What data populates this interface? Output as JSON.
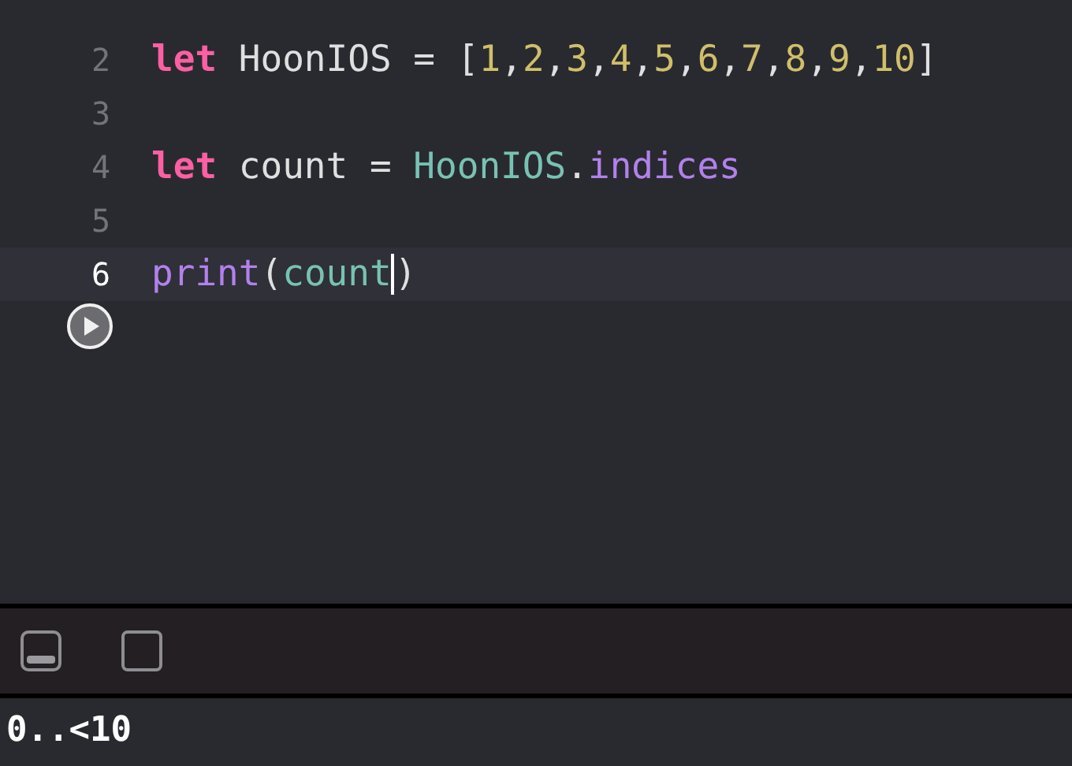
{
  "editor": {
    "lines": [
      {
        "number": "2",
        "current": false,
        "tokens": [
          {
            "kind": "keyword",
            "text": "let"
          },
          {
            "kind": "plain",
            "text": " HoonIOS = ["
          },
          {
            "kind": "number",
            "text": "1"
          },
          {
            "kind": "plain",
            "text": ","
          },
          {
            "kind": "number",
            "text": "2"
          },
          {
            "kind": "plain",
            "text": ","
          },
          {
            "kind": "number",
            "text": "3"
          },
          {
            "kind": "plain",
            "text": ","
          },
          {
            "kind": "number",
            "text": "4"
          },
          {
            "kind": "plain",
            "text": ","
          },
          {
            "kind": "number",
            "text": "5"
          },
          {
            "kind": "plain",
            "text": ","
          },
          {
            "kind": "number",
            "text": "6"
          },
          {
            "kind": "plain",
            "text": ","
          },
          {
            "kind": "number",
            "text": "7"
          },
          {
            "kind": "plain",
            "text": ","
          },
          {
            "kind": "number",
            "text": "8"
          },
          {
            "kind": "plain",
            "text": ","
          },
          {
            "kind": "number",
            "text": "9"
          },
          {
            "kind": "plain",
            "text": ","
          },
          {
            "kind": "number",
            "text": "10"
          },
          {
            "kind": "plain",
            "text": "]"
          }
        ]
      },
      {
        "number": "3",
        "current": false
      },
      {
        "number": "4",
        "current": false,
        "tokens": [
          {
            "kind": "keyword",
            "text": "let"
          },
          {
            "kind": "plain",
            "text": " count = "
          },
          {
            "kind": "variable",
            "text": "HoonIOS"
          },
          {
            "kind": "plain",
            "text": "."
          },
          {
            "kind": "member",
            "text": "indices"
          }
        ]
      },
      {
        "number": "5",
        "current": false
      },
      {
        "number": "6",
        "current": true,
        "tokens": [
          {
            "kind": "member",
            "text": "print"
          },
          {
            "kind": "plain",
            "text": "("
          },
          {
            "kind": "variable",
            "text": "count",
            "cursor_after": true
          },
          {
            "kind": "plain",
            "text": ")"
          }
        ]
      }
    ]
  },
  "console": {
    "output": "0..<10"
  }
}
